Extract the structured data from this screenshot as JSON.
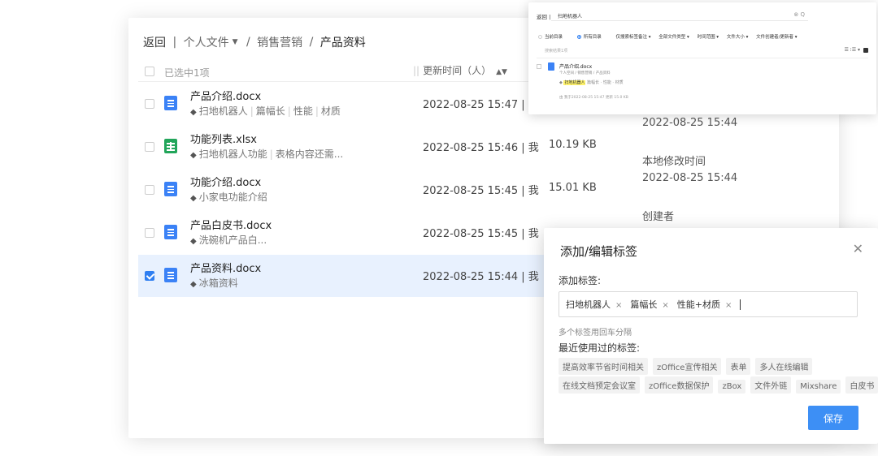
{
  "breadcrumb": {
    "back": "返回",
    "separator": "|",
    "root": "个人文件",
    "level1": "销售营销",
    "current": "产品资料",
    "slash": "/"
  },
  "list": {
    "selected_count": "已选中1项",
    "col_updated": "更新时间（人）"
  },
  "files": [
    {
      "name": "产品介绍.docx",
      "type": "doc",
      "tags": [
        "扫地机器人",
        "篇幅长",
        "性能",
        "材质"
      ],
      "updated": "2022-08-25 15:47 | 我",
      "size": "",
      "checked": false
    },
    {
      "name": "功能列表.xlsx",
      "type": "xls",
      "tags": [
        "扫地机器人功能",
        "表格内容还需..."
      ],
      "updated": "2022-08-25 15:46 | 我",
      "size": "10.19 KB",
      "checked": false
    },
    {
      "name": "功能介绍.docx",
      "type": "doc",
      "tags": [
        "小家电功能介绍"
      ],
      "updated": "2022-08-25 15:45 | 我",
      "size": "15.01 KB",
      "checked": false
    },
    {
      "name": "产品白皮书.docx",
      "type": "doc",
      "tags": [
        "洗碗机产品白..."
      ],
      "updated": "2022-08-25 15:45 | 我",
      "size": "",
      "checked": false
    },
    {
      "name": "产品资料.docx",
      "type": "doc",
      "tags": [
        "冰箱资料"
      ],
      "updated": "2022-08-25 15:44 | 我",
      "size": "",
      "checked": true
    }
  ],
  "details": {
    "created_time_value": "2022-08-25 15:44",
    "local_modified_label": "本地修改时间",
    "local_modified_value": "2022-08-25 15:44",
    "creator_label": "创建者"
  },
  "mini": {
    "back": "返回 |",
    "search_value": "扫地机器人",
    "search_icons": "⊗ Q",
    "filters": {
      "current_dir": "当前目录",
      "all_dir": "所有目录",
      "tag_note": "仅搜索标签备注 ▾",
      "file_types": "全部文件类型 ▾",
      "time_range": "时间范围 ▾",
      "file_size": "文件大小 ▾",
      "creator": "文件创建者/更新者 ▾"
    },
    "result_count": "搜索结果1项",
    "tools": "☰ ⁝☰ ▾",
    "result": {
      "name": "产品介绍.docx",
      "path": "个人空间 / 销售营销 / 产品资料",
      "tag_highlight": "扫地机器人",
      "tags_rest": "篇幅长 · 性能 · 材质",
      "info": "由 我于2022-08-25 15:47 更新 15.0 KB"
    }
  },
  "dialog": {
    "title": "添加/编辑标签",
    "close": "✕",
    "add_label": "添加标签:",
    "current_tags": [
      "扫地机器人",
      "篇幅长",
      "性能+材质"
    ],
    "tag_remove": "×",
    "hint": "多个标签用回车分隔",
    "recent_label": "最近使用过的标签:",
    "recent_row1": [
      "提高效率节省时间相关",
      "zOffice宣传相关",
      "表单",
      "多人在线编辑"
    ],
    "recent_row2": [
      "在线文档预定会议室",
      "zOffice数据保护",
      "zBox",
      "文件外链",
      "Mixshare",
      "白皮书"
    ],
    "save": "保存"
  },
  "colors": {
    "accent": "#2f7ff1",
    "doc_icon": "#3b82f6",
    "xls_icon": "#22a55a",
    "selected_row": "#e8f1fe",
    "save_button": "#3d8ff5"
  },
  "icons": {
    "doc": "document-icon",
    "xls": "spreadsheet-icon",
    "tag": "tag-icon",
    "close": "close-icon",
    "search": "search-icon",
    "clear": "clear-icon"
  }
}
